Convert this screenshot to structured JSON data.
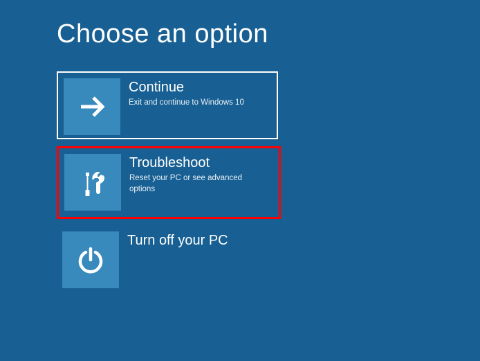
{
  "title": "Choose an option",
  "options": [
    {
      "title": "Continue",
      "desc": "Exit and continue to Windows 10"
    },
    {
      "title": "Troubleshoot",
      "desc": "Reset your PC or see advanced options"
    },
    {
      "title": "Turn off your PC",
      "desc": ""
    }
  ]
}
